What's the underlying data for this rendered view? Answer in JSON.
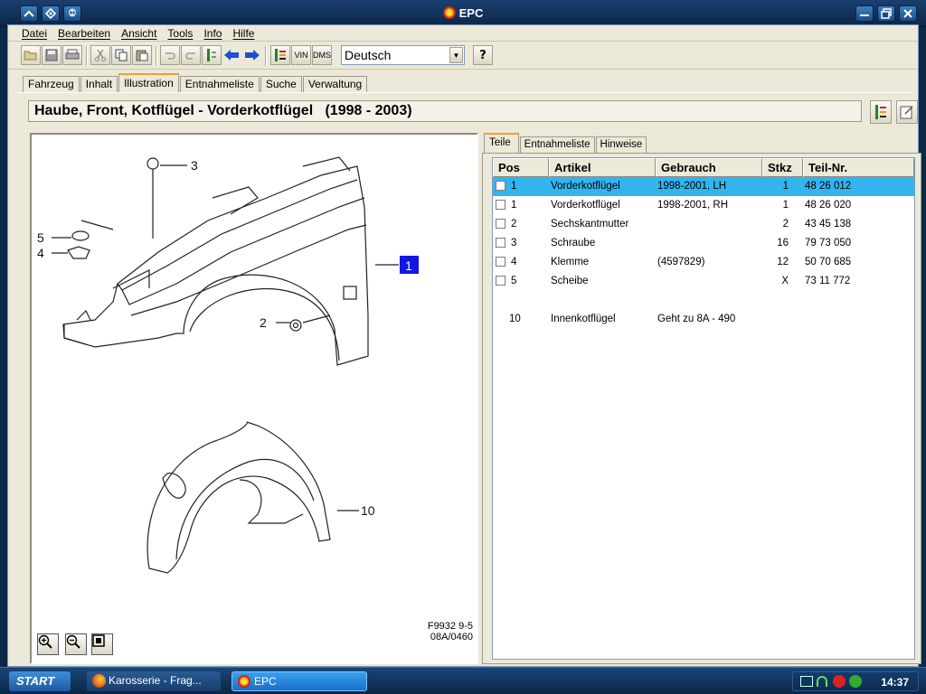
{
  "window": {
    "title": "EPC"
  },
  "menu": [
    "Datei",
    "Bearbeiten",
    "Ansicht",
    "Tools",
    "Info",
    "Hilfe"
  ],
  "toolbar": {
    "language": "Deutsch",
    "vin_label": "VIN",
    "dms_label": "DMS",
    "help_label": "?"
  },
  "main_tabs": [
    "Fahrzeug",
    "Inhalt",
    "Illustration",
    "Entnahmeliste",
    "Suche",
    "Verwaltung"
  ],
  "active_main_tab": "Illustration",
  "headline": "Haube, Front, Kotflügel - Vorderkotflügel   (1998 - 2003)",
  "illustration": {
    "callouts": [
      "1",
      "2",
      "3",
      "4",
      "5",
      "10"
    ],
    "reference_line1": "F9932 9-5",
    "reference_line2": "08A/0460"
  },
  "sub_tabs": [
    "Teile",
    "Entnahmeliste",
    "Hinweise"
  ],
  "active_sub_tab": "Teile",
  "table": {
    "headers": [
      "Pos",
      "Artikel",
      "Gebrauch",
      "Stkz",
      "Teil-Nr."
    ],
    "rows": [
      {
        "pos": "1",
        "artikel": "Vorderkotflügel",
        "gebrauch": "1998-2001, LH",
        "stkz": "1",
        "teilnr": "48 26 012",
        "selected": true,
        "checkbox": true
      },
      {
        "pos": "1",
        "artikel": "Vorderkotflügel",
        "gebrauch": "1998-2001, RH",
        "stkz": "1",
        "teilnr": "48 26 020",
        "selected": false,
        "checkbox": true
      },
      {
        "pos": "2",
        "artikel": "Sechskantmutter",
        "gebrauch": "",
        "stkz": "2",
        "teilnr": "43 45 138",
        "selected": false,
        "checkbox": true
      },
      {
        "pos": "3",
        "artikel": "Schraube",
        "gebrauch": "",
        "stkz": "16",
        "teilnr": "79 73 050",
        "selected": false,
        "checkbox": true
      },
      {
        "pos": "4",
        "artikel": "Klemme",
        "gebrauch": "(4597829)",
        "stkz": "12",
        "teilnr": "50 70 685",
        "selected": false,
        "checkbox": true
      },
      {
        "pos": "5",
        "artikel": "Scheibe",
        "gebrauch": "",
        "stkz": "X",
        "teilnr": "73 11 772",
        "selected": false,
        "checkbox": true
      },
      {
        "pos": "10",
        "artikel": "Innenkotflügel",
        "gebrauch": "Geht zu 8A - 490",
        "stkz": "",
        "teilnr": "",
        "selected": false,
        "checkbox": false
      }
    ]
  },
  "taskbar": {
    "start_label": "START",
    "tasks": [
      "Karosserie - Frag...",
      "EPC"
    ],
    "clock": "14:37"
  },
  "colors": {
    "selection": "#33b4ef",
    "callout_box": "#1515e0",
    "tab_accent": "#f0a030"
  }
}
